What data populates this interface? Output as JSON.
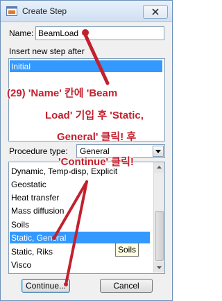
{
  "window": {
    "title": "Create Step"
  },
  "name_field": {
    "label": "Name:",
    "value": "BeamLoad"
  },
  "insert_after": {
    "label": "Insert new step after",
    "items": [
      "Initial"
    ],
    "selected": "Initial"
  },
  "procedure": {
    "label": "Procedure type:",
    "selected": "General"
  },
  "procedure_list": {
    "items": [
      "Dynamic, Temp-disp, Explicit",
      "Geostatic",
      "Heat transfer",
      "Mass diffusion",
      "Soils",
      "Static, General",
      "Static, Riks",
      "Visco"
    ],
    "selected": "Static, General",
    "tooltip": "Soils"
  },
  "buttons": {
    "continue": "Continue...",
    "cancel": "Cancel"
  },
  "annotation": {
    "line1": "(29) 'Name' 칸에 'Beam",
    "line2": "Load' 기입 후 'Static,",
    "line3": "General' 클릭! 후",
    "line4": "'Continue' 클릭!"
  },
  "colors": {
    "accent": "#3399ff",
    "annotation": "#c3202e"
  }
}
